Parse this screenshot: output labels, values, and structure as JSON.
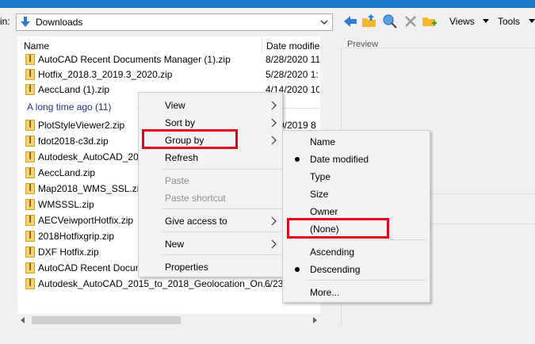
{
  "toolbar": {
    "look_in_label": "in:",
    "location": "Downloads",
    "views_label": "Views",
    "tools_label": "Tools"
  },
  "columns": {
    "name": "Name",
    "date": "Date modifie"
  },
  "files_top": [
    {
      "name": "AutoCAD Recent Documents Manager (1).zip",
      "date": "8/28/2020 11"
    },
    {
      "name": "Hotfix_2018.3_2019.3_2020.zip",
      "date": "5/28/2020 1:"
    },
    {
      "name": "AeccLand (1).zip",
      "date": "4/14/2020 10"
    }
  ],
  "group": {
    "label": "A long time ago (11)"
  },
  "files_old": [
    {
      "name": "PlotStyleViewer2.zip",
      "date": "0/2019 8"
    },
    {
      "name": "fdot2018-c3d.zip",
      "date": ""
    },
    {
      "name": "Autodesk_AutoCAD_201",
      "date": ""
    },
    {
      "name": "AeccLand.zip",
      "date": ""
    },
    {
      "name": "Map2018_WMS_SSL.zip",
      "date": ""
    },
    {
      "name": "WMSSSL.zip",
      "date": ""
    },
    {
      "name": "AECVeiwportHotfix.zip",
      "date": ""
    },
    {
      "name": "2018Hotfixgrip.zip",
      "date": ""
    },
    {
      "name": "DXF Hotfix.zip",
      "date": ""
    },
    {
      "name": "AutoCAD Recent Docum",
      "date": ""
    },
    {
      "name": "Autodesk_AutoCAD_2015_to_2018_Geolocation_On...",
      "date": "6/23"
    }
  ],
  "preview": {
    "label": "Preview"
  },
  "context_menu": {
    "view": "View",
    "sort_by": "Sort by",
    "group_by": "Group by",
    "refresh": "Refresh",
    "paste": "Paste",
    "paste_shortcut": "Paste shortcut",
    "give_access": "Give access to",
    "new": "New",
    "properties": "Properties"
  },
  "group_submenu": {
    "name": "Name",
    "date_modified": "Date modified",
    "type": "Type",
    "size": "Size",
    "owner": "Owner",
    "none": "(None)",
    "ascending": "Ascending",
    "descending": "Descending",
    "more": "More..."
  },
  "colors": {
    "highlight_red": "#e0001b",
    "group_header_blue": "#1e3287",
    "titlebar_blue": "#1979ca"
  }
}
